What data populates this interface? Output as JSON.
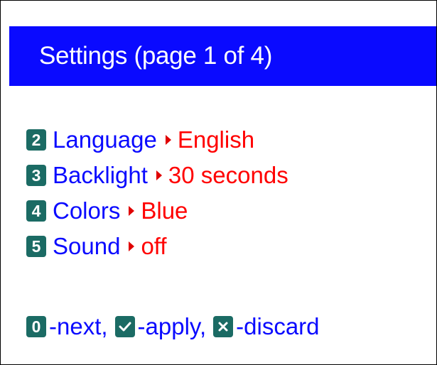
{
  "title": "Settings (page 1 of 4)",
  "items": [
    {
      "key": "2",
      "label": "Language",
      "value": "English"
    },
    {
      "key": "3",
      "label": "Backlight",
      "value": "30 seconds"
    },
    {
      "key": "4",
      "label": "Colors",
      "value": "Blue"
    },
    {
      "key": "5",
      "label": "Sound",
      "value": "off"
    }
  ],
  "footer": {
    "next_key": "0",
    "next_label": "-next,",
    "apply_icon": "checkmark-icon",
    "apply_label": "-apply,",
    "discard_icon": "x-icon",
    "discard_label": "-discard"
  },
  "colors": {
    "title_bar": "#0a0aff",
    "label": "#0a0aff",
    "value": "#ff0000",
    "badge": "#1b6b64",
    "background": "#ffffff"
  }
}
